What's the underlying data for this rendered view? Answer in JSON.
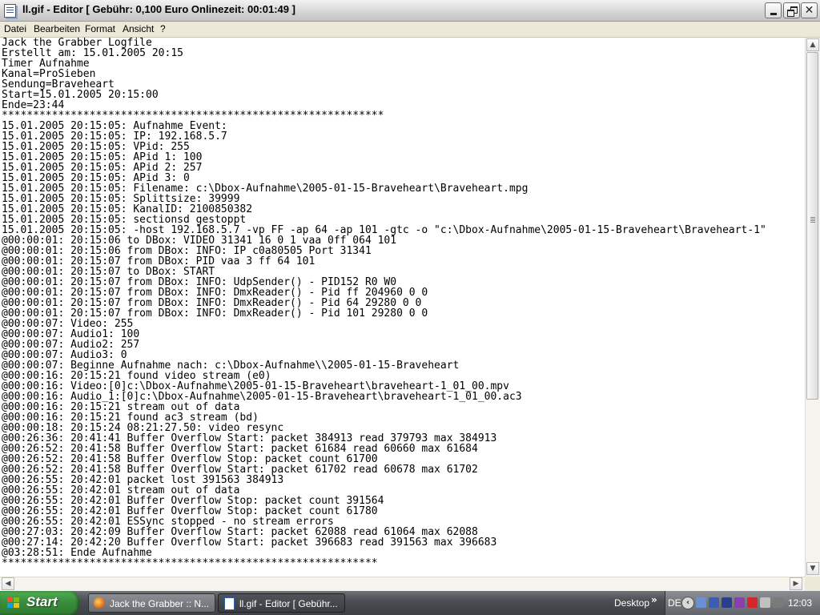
{
  "window": {
    "title": "ll.gif - Editor [ Gebühr: 0,100 Euro Onlinezeit: 00:01:49 ]",
    "menu": [
      "Datei",
      "Bearbeiten",
      "Format",
      "Ansicht",
      "?"
    ]
  },
  "document": {
    "lines": [
      "Jack the Grabber Logfile",
      "Erstellt am: 15.01.2005 20:15",
      "Timer Aufnahme",
      "Kanal=ProSieben",
      "Sendung=Braveheart",
      "Start=15.01.2005 20:15:00",
      "Ende=23:44",
      "*************************************************************",
      "15.01.2005 20:15:05: Aufnahme Event:",
      "15.01.2005 20:15:05: IP: 192.168.5.7",
      "15.01.2005 20:15:05: VPid: 255",
      "15.01.2005 20:15:05: APid 1: 100",
      "15.01.2005 20:15:05: APid 2: 257",
      "15.01.2005 20:15:05: APid 3: 0",
      "15.01.2005 20:15:05: Filename: c:\\Dbox-Aufnahme\\2005-01-15-Braveheart\\Braveheart.mpg",
      "15.01.2005 20:15:05: Splittsize: 39999",
      "15.01.2005 20:15:05: KanalID: 2100850382",
      "15.01.2005 20:15:05: sectionsd gestoppt",
      "15.01.2005 20:15:05: -host 192.168.5.7 -vp FF -ap 64 -ap 101 -gtc -o \"c:\\Dbox-Aufnahme\\2005-01-15-Braveheart\\Braveheart-1\"",
      "@00:00:01: 20:15:06 to DBox: VIDEO 31341 16 0 1 vaa 0ff 064 101",
      "@00:00:01: 20:15:06 from DBox: INFO: IP c0a80505 Port 31341",
      "@00:00:01: 20:15:07 from DBox: PID vaa 3 ff 64 101",
      "@00:00:01: 20:15:07 to DBox: START",
      "@00:00:01: 20:15:07 from DBox: INFO: UdpSender() - PID152 R0 W0",
      "@00:00:01: 20:15:07 from DBox: INFO: DmxReader() - Pid ff 204960 0 0",
      "@00:00:01: 20:15:07 from DBox: INFO: DmxReader() - Pid 64 29280 0 0",
      "@00:00:01: 20:15:07 from DBox: INFO: DmxReader() - Pid 101 29280 0 0",
      "@00:00:07: Video: 255",
      "@00:00:07: Audio1: 100",
      "@00:00:07: Audio2: 257",
      "@00:00:07: Audio3: 0",
      "@00:00:07: Beginne Aufnahme nach: c:\\Dbox-Aufnahme\\\\2005-01-15-Braveheart",
      "@00:00:16: 20:15:21 found video stream (e0)",
      "@00:00:16: Video:[0]c:\\Dbox-Aufnahme\\2005-01-15-Braveheart\\braveheart-1_01_00.mpv",
      "@00:00:16: Audio_1:[0]c:\\Dbox-Aufnahme\\2005-01-15-Braveheart\\braveheart-1_01_00.ac3",
      "@00:00:16: 20:15:21 stream out of data",
      "@00:00:16: 20:15:21 found ac3 stream (bd)",
      "@00:00:18: 20:15:24 08:21:27.50: video resync",
      "@00:26:36: 20:41:41 Buffer Overflow Start: packet 384913 read 379793 max 384913",
      "@00:26:52: 20:41:58 Buffer Overflow Start: packet 61684 read 60660 max 61684",
      "@00:26:52: 20:41:58 Buffer Overflow Stop: packet count 61700",
      "@00:26:52: 20:41:58 Buffer Overflow Start: packet 61702 read 60678 max 61702",
      "@00:26:55: 20:42:01 packet lost 391563 384913",
      "@00:26:55: 20:42:01 stream out of data",
      "@00:26:55: 20:42:01 Buffer Overflow Stop: packet count 391564",
      "@00:26:55: 20:42:01 Buffer Overflow Stop: packet count 61780",
      "@00:26:55: 20:42:01 ESSync stopped - no stream errors",
      "@00:27:03: 20:42:09 Buffer Overflow Start: packet 62088 read 61064 max 62088",
      "@00:27:14: 20:42:20 Buffer Overflow Start: packet 396683 read 391563 max 396683",
      "@03:28:51: Ende Aufnahme",
      "************************************************************"
    ]
  },
  "taskbar": {
    "start_label": "Start",
    "tasks": [
      {
        "label": "Jack the Grabber :: N...",
        "icon": "firefox-icon",
        "active": false
      },
      {
        "label": "ll.gif - Editor [ Gebühr...",
        "icon": "notepad-icon",
        "active": true
      }
    ],
    "desktop_label": "Desktop",
    "chevron": "»",
    "lang": "DE",
    "clock": "12:03"
  },
  "colors": {
    "taskbar": "#4a4e52",
    "start_button": "#3a8d3c",
    "editor_background": "#ffffff",
    "text": "#000000"
  }
}
